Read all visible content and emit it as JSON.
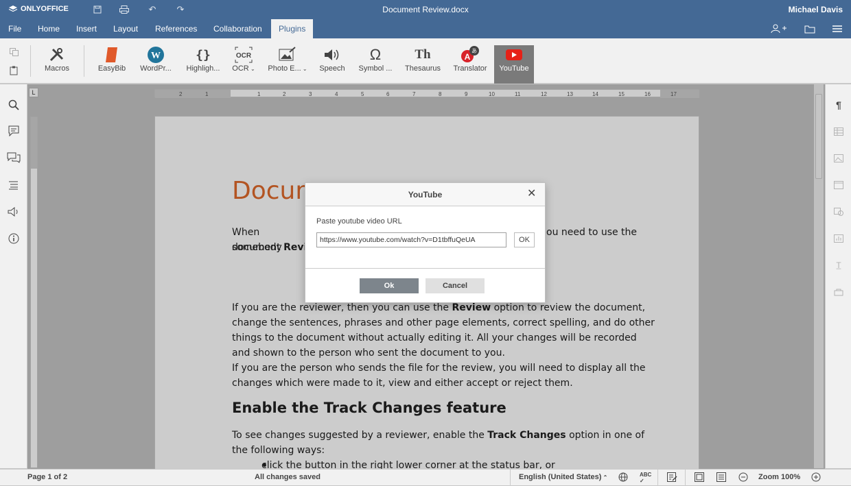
{
  "app": {
    "logo": "ONLYOFFICE",
    "doc_title": "Document Review.docx",
    "user": "Michael Davis"
  },
  "menu": {
    "tabs": [
      "File",
      "Home",
      "Insert",
      "Layout",
      "References",
      "Collaboration",
      "Plugins"
    ],
    "active": "Plugins"
  },
  "plugins": [
    {
      "label": "Macros"
    },
    {
      "label": "EasyBib"
    },
    {
      "label": "WordPr..."
    },
    {
      "label": "Highligh..."
    },
    {
      "label": "OCR"
    },
    {
      "label": "Photo E..."
    },
    {
      "label": "Speech"
    },
    {
      "label": "Symbol ..."
    },
    {
      "label": "Thesaurus"
    },
    {
      "label": "Translator"
    },
    {
      "label": "YouTube"
    }
  ],
  "ocr_glyph": "OCR",
  "th_glyph": "Th",
  "document": {
    "title_partial": "Docum",
    "para1_start": "When somebody",
    "para1_end": "ou need to use the",
    "para1_line2_a": "document ",
    "para1_line2_b": "Revie",
    "para2": [
      "If you are the reviewer, then you can use the ",
      "Review",
      " option to review the document, change the sentences, phrases and other page elements, correct spelling, and do other things to the document without actually editing it. All your changes will be recorded and shown to the person who sent the document to you."
    ],
    "para3": "If you are the person who sends the file for the review, you will need to display all the changes which were made to it, view and either accept or reject them.",
    "heading2": "Enable the Track Changes feature",
    "para4": [
      "To see changes suggested by a reviewer, enable the ",
      "Track Changes",
      " option in one of the following ways:"
    ],
    "bullet1": "click the   button in the right lower corner at the status bar, or"
  },
  "dialog": {
    "title": "YouTube",
    "label": "Paste youtube video URL",
    "url_value": "https://www.youtube.com/watch?v=D1tbffuQeUA",
    "inline_ok": "OK",
    "ok": "Ok",
    "cancel": "Cancel"
  },
  "status": {
    "page": "Page 1 of 2",
    "saved": "All changes saved",
    "language": "English (United States)",
    "zoom": "Zoom 100%"
  },
  "colors": {
    "header": "#446995",
    "title_orange": "#e06a2b"
  }
}
